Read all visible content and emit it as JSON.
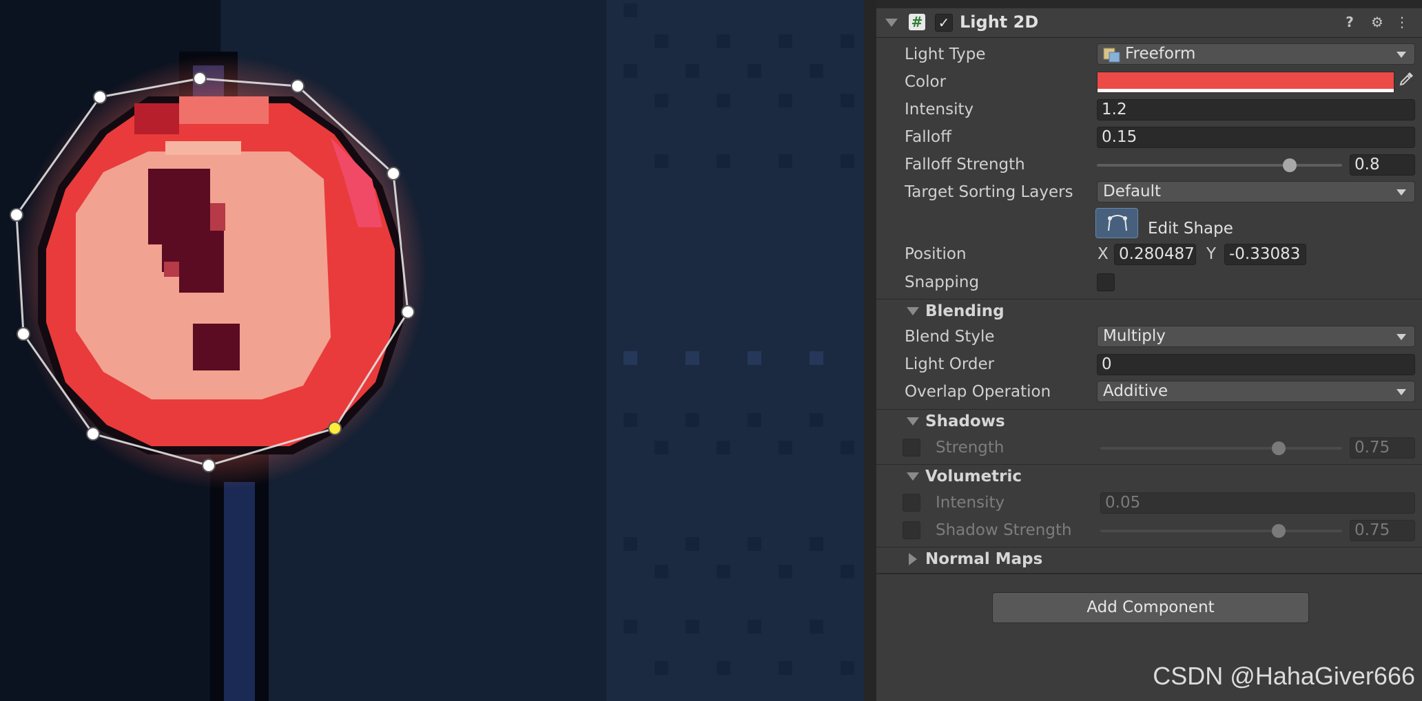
{
  "component": {
    "title": "Light 2D",
    "enabled_check": "✓",
    "script_icon": "#",
    "icons": {
      "help": "?",
      "presets": "⚙",
      "menu": "⋮"
    }
  },
  "light_type": {
    "label": "Light Type",
    "value": "Freeform"
  },
  "color": {
    "label": "Color",
    "hex": "#ec4a47"
  },
  "intensity": {
    "label": "Intensity",
    "value": "1.2"
  },
  "falloff": {
    "label": "Falloff",
    "value": "0.15"
  },
  "falloff_strength": {
    "label": "Falloff Strength",
    "value": "0.8",
    "slider_fraction": 0.8
  },
  "target_sorting_layers": {
    "label": "Target Sorting Layers",
    "value": "Default"
  },
  "edit_shape": {
    "label": "Edit Shape"
  },
  "position": {
    "label": "Position",
    "x_label": "X",
    "x": "0.280487",
    "y_label": "Y",
    "y": "-0.33083"
  },
  "snapping": {
    "label": "Snapping"
  },
  "blending": {
    "title": "Blending",
    "blend_style": {
      "label": "Blend Style",
      "value": "Multiply"
    },
    "light_order": {
      "label": "Light Order",
      "value": "0"
    },
    "overlap_operation": {
      "label": "Overlap Operation",
      "value": "Additive"
    }
  },
  "shadows": {
    "title": "Shadows",
    "strength": {
      "label": "Strength",
      "value": "0.75",
      "slider_fraction": 0.75
    }
  },
  "volumetric": {
    "title": "Volumetric",
    "intensity": {
      "label": "Intensity",
      "value": "0.05"
    },
    "shadow_strength": {
      "label": "Shadow Strength",
      "value": "0.75",
      "slider_fraction": 0.75
    }
  },
  "normal_maps": {
    "title": "Normal Maps"
  },
  "add_component": "Add Component",
  "watermark": "CSDN @HahaGiver666"
}
